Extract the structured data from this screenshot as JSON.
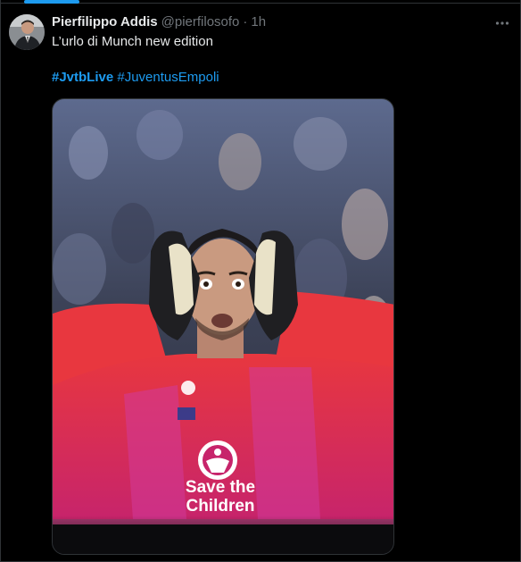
{
  "tweet": {
    "author_name": "Pierfilippo Addis",
    "author_handle": "@pierfilosofo",
    "separator": "·",
    "time": "1h",
    "text": "L’urlo di Munch new edition",
    "hashtags": [
      {
        "label": "#JvtbLive",
        "bold": true
      },
      {
        "label": "#JuventusEmpoli",
        "bold": false
      }
    ],
    "media": {
      "shirt_text_line1": "Save the",
      "shirt_text_line2": "Children"
    }
  },
  "icons": {
    "more": "more-horizontal-icon",
    "avatar": "avatar"
  },
  "colors": {
    "background": "#000000",
    "text": "#e7e9ea",
    "muted": "#71767b",
    "link": "#1d9bf0",
    "border": "#2f3336"
  }
}
